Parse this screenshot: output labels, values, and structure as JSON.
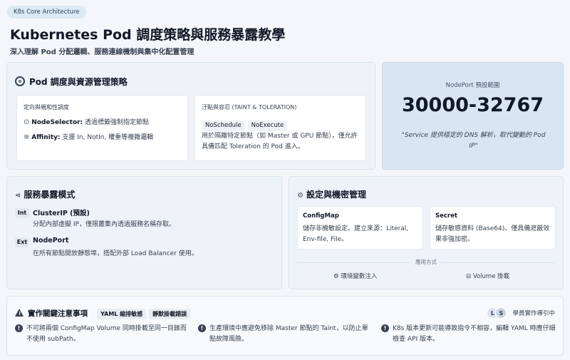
{
  "header": {
    "pill": "K8s Core Architecture",
    "title": "Kubernetes Pod 調度策略與服務暴露教學",
    "subtitle": "深入理解 Pod 分配邏輯、服務連線機制與集中化配置管理"
  },
  "scheduling": {
    "title": "Pod 調度與資源管理策略",
    "affinity_card": {
      "heading": "定向與親和性調度",
      "items": [
        {
          "icon": "check-circle-icon",
          "label": "NodeSelector:",
          "text": " 透過標籤強制指定節點"
        },
        {
          "icon": "layers-icon",
          "label": "Affinity:",
          "text": " 支援 In, NotIn, 權重等複雜邏輯"
        }
      ]
    },
    "taint_card": {
      "heading": "汙點與容忍 (TAINT & TOLERATION)",
      "tags": [
        "NoSchedule",
        "NoExecute"
      ],
      "text": "用於隔離特定節點（如 Master 或 GPU 節點），僅允許具備匹配 Toleration 的 Pod 進入。"
    }
  },
  "nodeport": {
    "label": "NodePort 預設範圍",
    "range": "30000-32767",
    "quote": "\"Service 提供穩定的 DNS 解析，取代變動的 Pod IP\""
  },
  "exposure": {
    "title": "服務暴露模式",
    "items": [
      {
        "badge": "Int",
        "name": "ClusterIP (預設)",
        "desc": "分配內部虛擬 IP，僅限叢集內透過服務名稱存取。"
      },
      {
        "badge": "Ext",
        "name": "NodePort",
        "desc": "在所有節點開放靜態埠，搭配外部 Load Balancer 使用。"
      }
    ]
  },
  "config": {
    "title": "設定與機密管理",
    "configmap": {
      "name": "ConfigMap",
      "desc": "儲存非機敏設定。建立來源：Literal, Env-file, File。"
    },
    "secret": {
      "name": "Secret",
      "desc": "儲存敏感資料 (Base64)。僅具備遮蔽效果非強加密。"
    },
    "apply_label": "應用方式",
    "methods": [
      "環境變數注入",
      "Volume 掛載"
    ]
  },
  "notes": {
    "title": "實作關鍵注意事項",
    "tags": [
      "YAML 縮排敏感",
      "靜默掛載錯誤"
    ],
    "avatars": [
      "L",
      "S"
    ],
    "guide": "學員實作導引中",
    "items": [
      "不可將兩個 ConfigMap Volume 同時掛載至同一目錄而不使用 subPath。",
      "生產環境中應避免移除 Master 節點的 Taint，以防止單點故障風險。",
      "K8s 版本更新可能導致指令不相容，編輯 YAML 時應仔細檢查 API 版本。"
    ]
  },
  "colors": {
    "accent_card": "#d8e6f3",
    "badge_bg": "#e2e8f0",
    "warning": "#f59e0b"
  }
}
